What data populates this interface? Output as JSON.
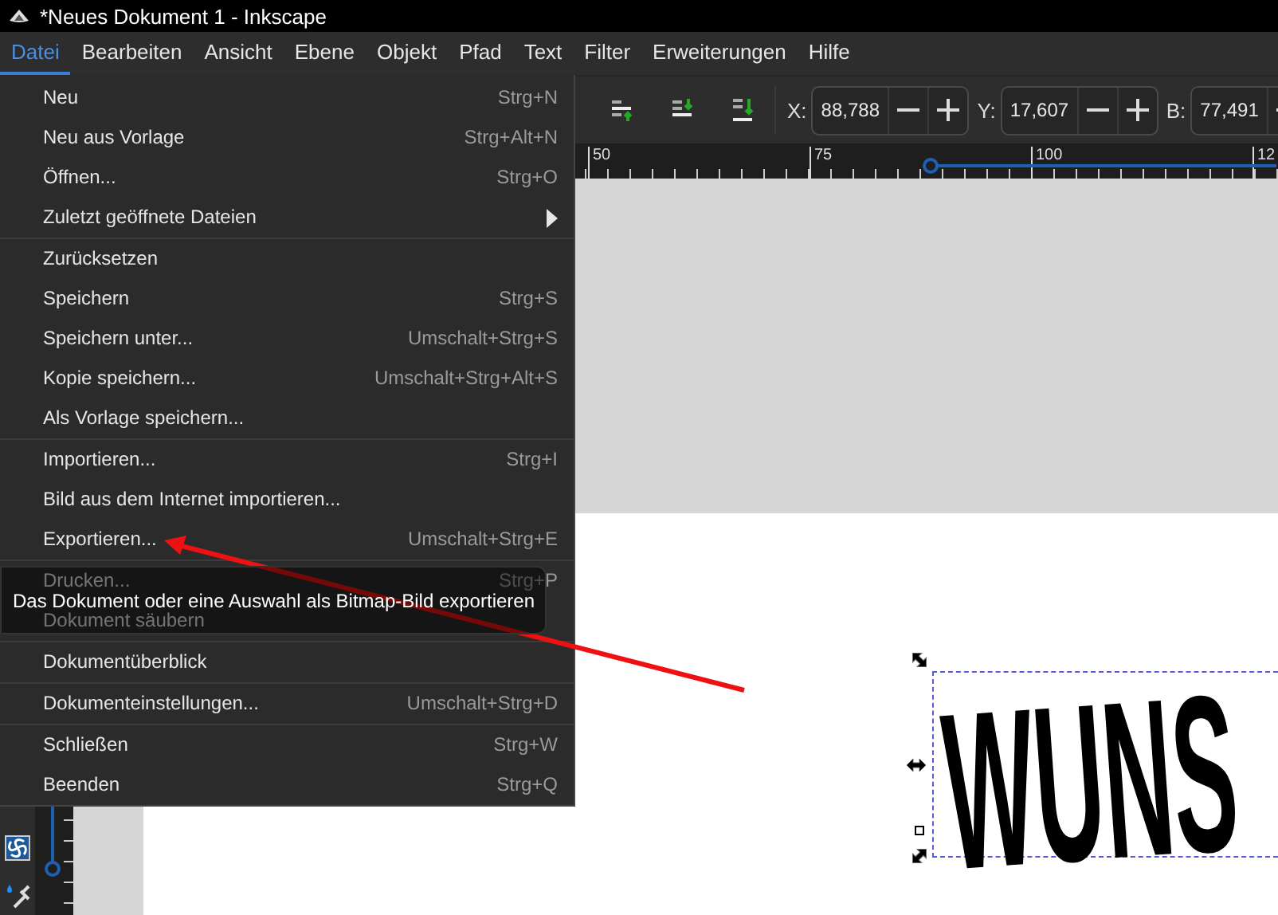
{
  "window": {
    "title": "*Neues Dokument 1 - Inkscape"
  },
  "menubar": [
    {
      "label": "Datei",
      "selected": true
    },
    {
      "label": "Bearbeiten",
      "selected": false
    },
    {
      "label": "Ansicht",
      "selected": false
    },
    {
      "label": "Ebene",
      "selected": false
    },
    {
      "label": "Objekt",
      "selected": false
    },
    {
      "label": "Pfad",
      "selected": false
    },
    {
      "label": "Text",
      "selected": false
    },
    {
      "label": "Filter",
      "selected": false
    },
    {
      "label": "Erweiterungen",
      "selected": false
    },
    {
      "label": "Hilfe",
      "selected": false
    }
  ],
  "toolbar": {
    "fields": [
      {
        "label": "X:",
        "value": "88,788"
      },
      {
        "label": "Y:",
        "value": "17,607"
      },
      {
        "label": "B:",
        "value": "77,491"
      }
    ]
  },
  "ruler": {
    "labels": [
      "50",
      "75",
      "100",
      "12"
    ]
  },
  "file_menu": {
    "groups": [
      [
        {
          "label": "Neu",
          "shortcut": "Strg+N",
          "submenu": false
        },
        {
          "label": "Neu aus Vorlage",
          "shortcut": "Strg+Alt+N",
          "submenu": false
        },
        {
          "label": "Öffnen...",
          "shortcut": "Strg+O",
          "submenu": false
        },
        {
          "label": "Zuletzt geöffnete Dateien",
          "submenu": true
        }
      ],
      [
        {
          "label": "Zurücksetzen",
          "submenu": false
        },
        {
          "label": "Speichern",
          "shortcut": "Strg+S",
          "submenu": false
        },
        {
          "label": "Speichern unter...",
          "shortcut": "Umschalt+Strg+S",
          "submenu": false
        },
        {
          "label": "Kopie speichern...",
          "shortcut": "Umschalt+Strg+Alt+S",
          "submenu": false
        },
        {
          "label": "Als Vorlage speichern...",
          "submenu": false
        }
      ],
      [
        {
          "label": "Importieren...",
          "shortcut": "Strg+I",
          "submenu": false
        },
        {
          "label": "Bild aus dem Internet importieren...",
          "submenu": false
        },
        {
          "label": "Exportieren...",
          "shortcut": "Umschalt+Strg+E",
          "submenu": false
        }
      ],
      [
        {
          "label": "Drucken...",
          "shortcut": "Strg+P",
          "submenu": false
        },
        {
          "label": "Dokument säubern",
          "submenu": false
        }
      ],
      [
        {
          "label": "Dokumentüberblick",
          "submenu": false
        }
      ],
      [
        {
          "label": "Dokumenteinstellungen...",
          "shortcut": "Umschalt+Strg+D",
          "submenu": false
        }
      ],
      [
        {
          "label": "Schließen",
          "shortcut": "Strg+W",
          "submenu": false
        },
        {
          "label": "Beenden",
          "shortcut": "Strg+Q",
          "submenu": false
        }
      ]
    ]
  },
  "tooltip": {
    "text": "Das Dokument oder eine Auswahl als Bitmap-Bild exportieren"
  },
  "canvas": {
    "artwork_text": "WUNS"
  }
}
